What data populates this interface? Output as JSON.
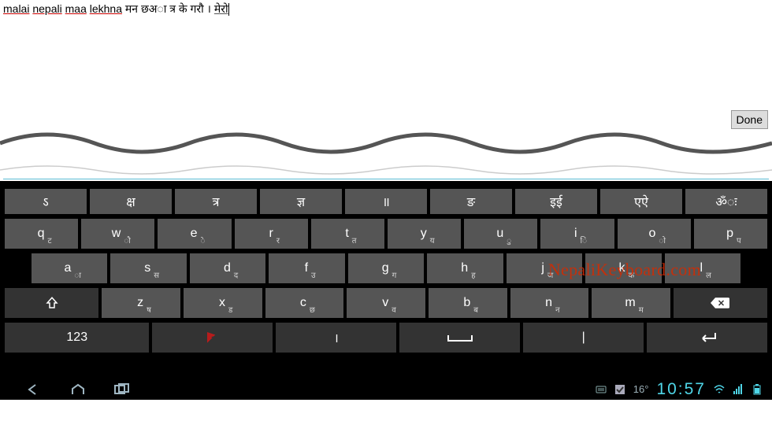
{
  "text": {
    "roman_words": [
      "malai",
      "nepali",
      "maa",
      "lekhna"
    ],
    "devanagari_segment": "मन छअा त्र के गरौ ।",
    "last_word": "मेरो"
  },
  "done_button": "Done",
  "suggestions": [
    "ऽ",
    "क्ष",
    "त्र",
    "ज्ञ",
    "॥",
    "ङ",
    "इई",
    "एऐ",
    "ॐः"
  ],
  "row1": [
    {
      "m": "q",
      "s": "ट"
    },
    {
      "m": "w",
      "s": "ौ"
    },
    {
      "m": "e",
      "s": "े"
    },
    {
      "m": "r",
      "s": "र"
    },
    {
      "m": "t",
      "s": "त"
    },
    {
      "m": "y",
      "s": "य"
    },
    {
      "m": "u",
      "s": "ु"
    },
    {
      "m": "i",
      "s": "ि"
    },
    {
      "m": "o",
      "s": "ो"
    },
    {
      "m": "p",
      "s": "प"
    }
  ],
  "row2": [
    {
      "m": "a",
      "s": "ा"
    },
    {
      "m": "s",
      "s": "स"
    },
    {
      "m": "d",
      "s": "द"
    },
    {
      "m": "f",
      "s": "उ"
    },
    {
      "m": "g",
      "s": "ग"
    },
    {
      "m": "h",
      "s": "ह"
    },
    {
      "m": "j",
      "s": "ज"
    },
    {
      "m": "k",
      "s": "क"
    },
    {
      "m": "l",
      "s": "ल"
    }
  ],
  "row3": [
    {
      "m": "z",
      "s": "ष"
    },
    {
      "m": "x",
      "s": "ड"
    },
    {
      "m": "c",
      "s": "छ"
    },
    {
      "m": "v",
      "s": "व"
    },
    {
      "m": "b",
      "s": "ब"
    },
    {
      "m": "n",
      "s": "न"
    },
    {
      "m": "m",
      "s": "म"
    }
  ],
  "bottom": {
    "num": "123",
    "period": "।",
    "pipe": "|"
  },
  "watermark": "NepaliKeyboard.com",
  "statusbar": {
    "temp": "16°",
    "time": "10:57"
  }
}
